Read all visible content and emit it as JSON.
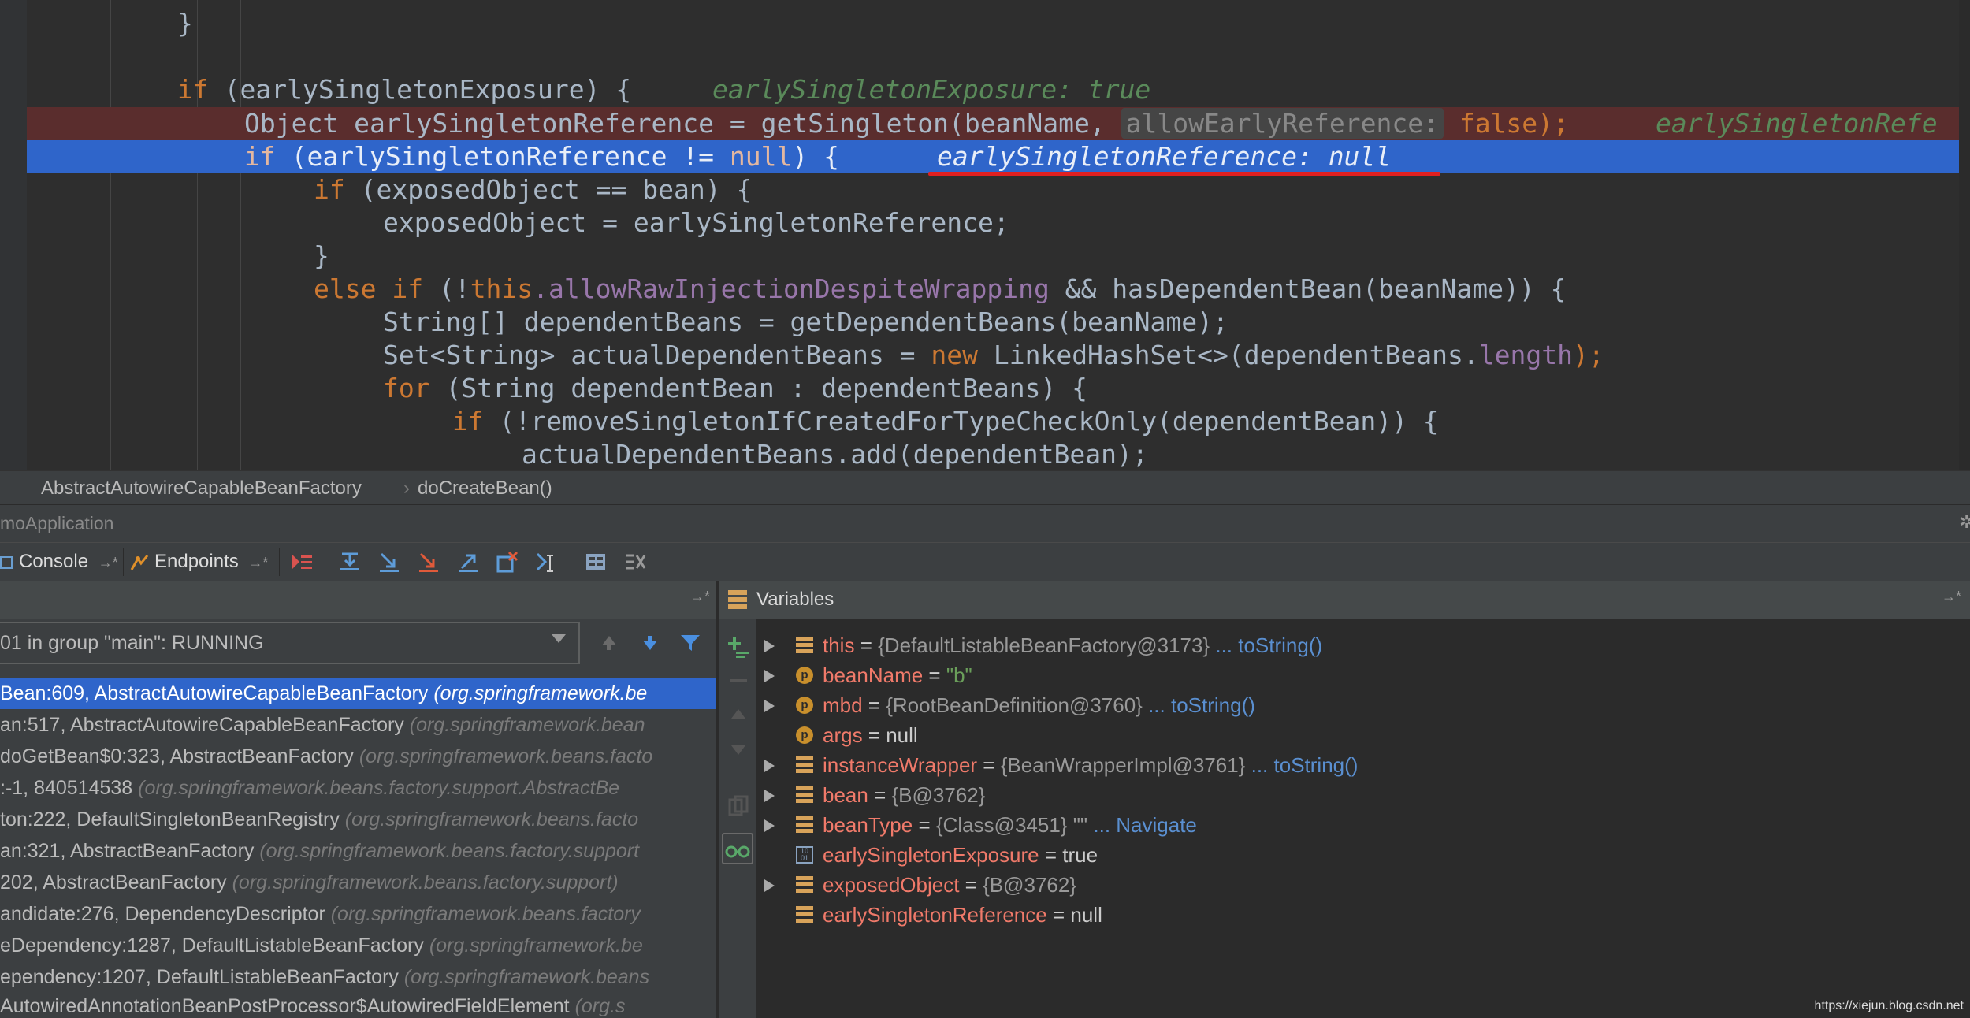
{
  "editor": {
    "lines": [
      {
        "indent": 2,
        "text": "}"
      },
      {
        "indent": 0,
        "text": ""
      },
      {
        "indent": 2,
        "kw": "if",
        "rest": " (earlySingletonExposure) {",
        "inline": "earlySingletonExposure: true"
      },
      {
        "indent": 3,
        "pre": "Object earlySingletonReference = getSingleton(beanName, ",
        "hint": "allowEarlyReference:",
        "post": " false);",
        "inline": "earlySingletonRefe"
      },
      {
        "indent": 3,
        "kw": "if",
        "rest": " (earlySingletonReference != ",
        "nullkw": "null",
        "rest2": ") {",
        "inline": "earlySingletonReference: null"
      },
      {
        "indent": 4,
        "kw": "if",
        "rest": " (exposedObject == bean) {"
      },
      {
        "indent": 5,
        "text": "exposedObject = earlySingletonReference;"
      },
      {
        "indent": 4,
        "text": "}"
      },
      {
        "indent": 4,
        "kw": "else if",
        "rest": " (!",
        "this": "this",
        "fld": ".allowRawInjectionDespiteWrapping",
        "rest2": " && hasDependentBean(beanName)) {"
      },
      {
        "indent": 5,
        "text": "String[] dependentBeans = getDependentBeans(beanName);"
      },
      {
        "indent": 5,
        "pre": "Set<String> actualDependentBeans = ",
        "kw": "new",
        "rest": " LinkedHashSet<>(dependentBeans.",
        "fld": "length",
        "rest2": ");"
      },
      {
        "indent": 5,
        "kw": "for",
        "rest": " (String dependentBean : dependentBeans) {"
      },
      {
        "indent": 6,
        "kw": "if",
        "rest": " (!removeSingletonIfCreatedForTypeCheckOnly(dependentBean)) {"
      },
      {
        "indent": 7,
        "text": "actualDependentBeans.add(dependentBean);"
      }
    ]
  },
  "breadcrumbs": {
    "class_name": "AbstractAutowireCapableBeanFactory",
    "method": "doCreateBean()"
  },
  "run_title": "moApplication",
  "toolbar": {
    "console_label": "Console",
    "console_pin": "→*",
    "endpoints_label": "Endpoints",
    "endpoints_pin": "→*"
  },
  "frames": {
    "header_pin": "→*",
    "thread": "01 in group \"main\": RUNNING",
    "rows": [
      {
        "loc": "Bean:609, AbstractAutowireCapableBeanFactory ",
        "pkg": "(org.springframework.be"
      },
      {
        "loc": "an:517, AbstractAutowireCapableBeanFactory ",
        "pkg": "(org.springframework.bean"
      },
      {
        "loc": "doGetBean$0:323, AbstractBeanFactory ",
        "pkg": "(org.springframework.beans.facto"
      },
      {
        "loc": ":-1, 840514538 ",
        "pkg": "(org.springframework.beans.factory.support.AbstractBe"
      },
      {
        "loc": "ton:222, DefaultSingletonBeanRegistry ",
        "pkg": "(org.springframework.beans.facto"
      },
      {
        "loc": "an:321, AbstractBeanFactory ",
        "pkg": "(org.springframework.beans.factory.support"
      },
      {
        "loc": "202, AbstractBeanFactory ",
        "pkg": "(org.springframework.beans.factory.support)"
      },
      {
        "loc": "andidate:276, DependencyDescriptor ",
        "pkg": "(org.springframework.beans.factory"
      },
      {
        "loc": "eDependency:1287, DefaultListableBeanFactory ",
        "pkg": "(org.springframework.be"
      },
      {
        "loc": "ependency:1207, DefaultListableBeanFactory ",
        "pkg": "(org.springframework.beans"
      },
      {
        "loc": "AutowiredAnnotationBeanPostProcessor$AutowiredFieldElement ",
        "pkg": "(org.s"
      }
    ]
  },
  "variables": {
    "title": "Variables",
    "pin": "→*",
    "rows": [
      {
        "icon": "field",
        "expand": true,
        "name": "this",
        "eq": " = ",
        "obj": "{DefaultListableBeanFactory@3173}",
        "link": " ... toString()"
      },
      {
        "icon": "param",
        "expand": true,
        "name": "beanName",
        "eq": " = ",
        "str": "\"b\""
      },
      {
        "icon": "param",
        "expand": true,
        "name": "mbd",
        "eq": " = ",
        "obj": "{RootBeanDefinition@3760}",
        "link": " ... toString()"
      },
      {
        "icon": "param",
        "expand": false,
        "name": "args",
        "eq": " = ",
        "val": "null"
      },
      {
        "icon": "field",
        "expand": true,
        "name": "instanceWrapper",
        "eq": " = ",
        "obj": "{BeanWrapperImpl@3761}",
        "link": " ... toString()"
      },
      {
        "icon": "field",
        "expand": true,
        "name": "bean",
        "eq": " = ",
        "obj": "{B@3762}"
      },
      {
        "icon": "field",
        "expand": true,
        "name": "beanType",
        "eq": " = ",
        "obj": "{Class@3451} \"\"",
        "link": " ... Navigate"
      },
      {
        "icon": "prim",
        "expand": false,
        "name": "earlySingletonExposure",
        "eq": " = ",
        "val": "true"
      },
      {
        "icon": "field",
        "expand": true,
        "name": "exposedObject",
        "eq": " = ",
        "obj": "{B@3762}"
      },
      {
        "icon": "field",
        "expand": false,
        "name": "earlySingletonReference",
        "eq": " = ",
        "val": "null"
      }
    ]
  },
  "watermark": "https://xiejun.blog.csdn.net"
}
